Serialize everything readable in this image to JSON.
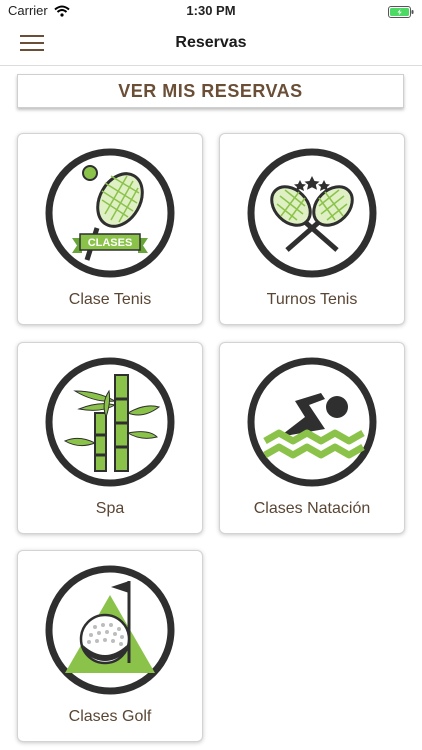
{
  "status_bar": {
    "carrier": "Carrier",
    "time": "1:30 PM"
  },
  "header": {
    "title": "Reservas"
  },
  "my_reservations": {
    "label": "VER MIS RESERVAS"
  },
  "cards": [
    {
      "label": "Clase Tenis",
      "icon": "tennis-class-icon",
      "badge": "CLASES"
    },
    {
      "label": "Turnos Tenis",
      "icon": "tennis-rackets-icon"
    },
    {
      "label": "Spa",
      "icon": "bamboo-icon"
    },
    {
      "label": "Clases Natación",
      "icon": "swimmer-icon"
    },
    {
      "label": "Clases Golf",
      "icon": "golf-icon"
    }
  ],
  "colors": {
    "accent": "#6b4e36",
    "green": "#8bc34a",
    "dark": "#2f2f2f"
  }
}
